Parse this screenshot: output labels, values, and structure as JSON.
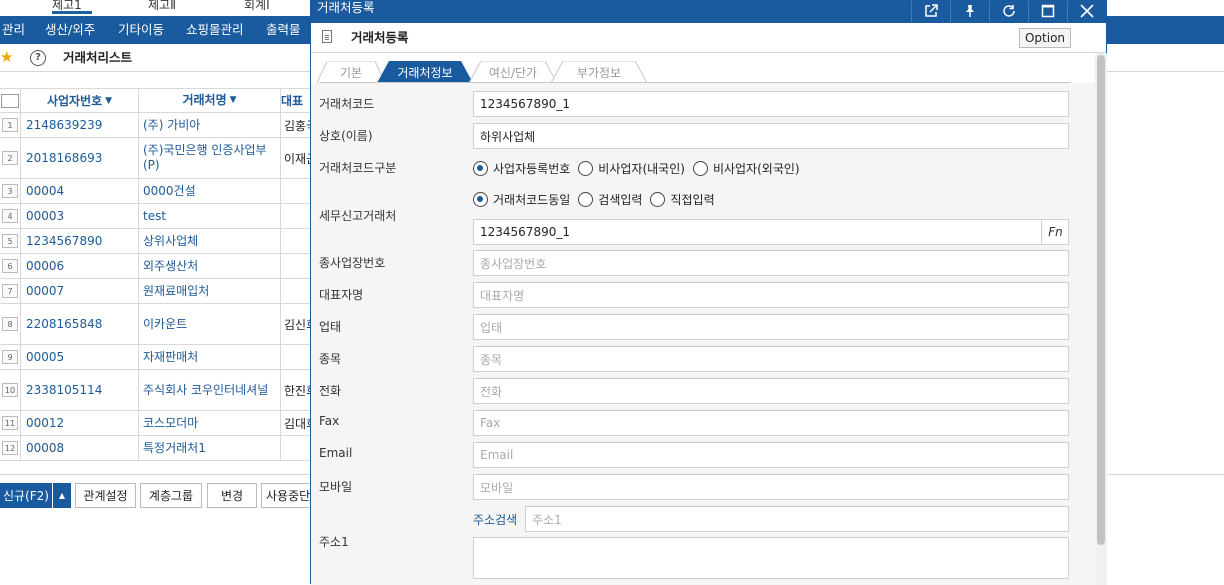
{
  "top_tabs": [
    {
      "label": "제고1"
    },
    {
      "label": "제고Ⅱ"
    },
    {
      "label": "회계Ⅰ"
    }
  ],
  "menu": [
    "관리",
    "생산/외주",
    "기타이동",
    "쇼핑몰관리",
    "출력물"
  ],
  "list": {
    "title": "거래처리스트",
    "headers": {
      "code": "사업자번호",
      "name": "거래처명",
      "ceo": "대표"
    },
    "rows": [
      {
        "num": "1",
        "code": "2148639239",
        "name": "(주) 가비아",
        "ceo": "김홍국"
      },
      {
        "num": "2",
        "code": "2018168693",
        "name": "(주)국민은행 인증사업부(P)",
        "ceo": "이재근"
      },
      {
        "num": "3",
        "code": "00004",
        "name": "0000건설",
        "ceo": ""
      },
      {
        "num": "4",
        "code": "00003",
        "name": "test",
        "ceo": ""
      },
      {
        "num": "5",
        "code": "1234567890",
        "name": "상위사업체",
        "ceo": ""
      },
      {
        "num": "6",
        "code": "00006",
        "name": "외주생산처",
        "ceo": ""
      },
      {
        "num": "7",
        "code": "00007",
        "name": "원재료매입처",
        "ceo": ""
      },
      {
        "num": "8",
        "code": "2208165848",
        "name": "이카운트",
        "ceo": "김신희"
      },
      {
        "num": "9",
        "code": "00005",
        "name": "자재판매처",
        "ceo": ""
      },
      {
        "num": "10",
        "code": "2338105114",
        "name": "주식회사 코우인터네셔널",
        "ceo": "한진희"
      },
      {
        "num": "11",
        "code": "00012",
        "name": "코스모더마",
        "ceo": "김대희"
      },
      {
        "num": "12",
        "code": "00008",
        "name": "특정거래처1",
        "ceo": ""
      }
    ]
  },
  "bottom_buttons": {
    "new": "신규(F2)",
    "relation": "관계설정",
    "hierarchy": "계층그룹",
    "change": "변경",
    "stop": "사용중단"
  },
  "modal": {
    "title": "거래처등록",
    "header_title": "거래처등록",
    "option": "Option",
    "tabs": [
      "기본",
      "거래처정보",
      "여신/단가",
      "부가정보"
    ],
    "active_tab": "거래처정보",
    "fields": {
      "code_label": "거래처코드",
      "code_value": "1234567890_1",
      "name_label": "상호(이름)",
      "name_value": "하위사업체",
      "type_label": "거래처코드구분",
      "type_options": [
        "사업자등록번호",
        "비사업자(내국인)",
        "비사업자(외국인)"
      ],
      "tax_label": "세무신고거래처",
      "tax_options": [
        "거래처코드동일",
        "검색입력",
        "직접입력"
      ],
      "tax_value": "1234567890_1",
      "fn": "Fn",
      "branch_label": "종사업장번호",
      "branch_placeholder": "종사업장번호",
      "ceo_label": "대표자명",
      "ceo_placeholder": "대표자명",
      "biz_label": "업태",
      "biz_placeholder": "업태",
      "item_label": "종목",
      "item_placeholder": "종목",
      "phone_label": "전화",
      "phone_placeholder": "전화",
      "fax_label": "Fax",
      "fax_placeholder": "Fax",
      "email_label": "Email",
      "email_placeholder": "Email",
      "mobile_label": "모바일",
      "mobile_placeholder": "모바일",
      "addr_label": "주소1",
      "addr_search": "주소검색",
      "addr_placeholder": "주소1"
    }
  }
}
